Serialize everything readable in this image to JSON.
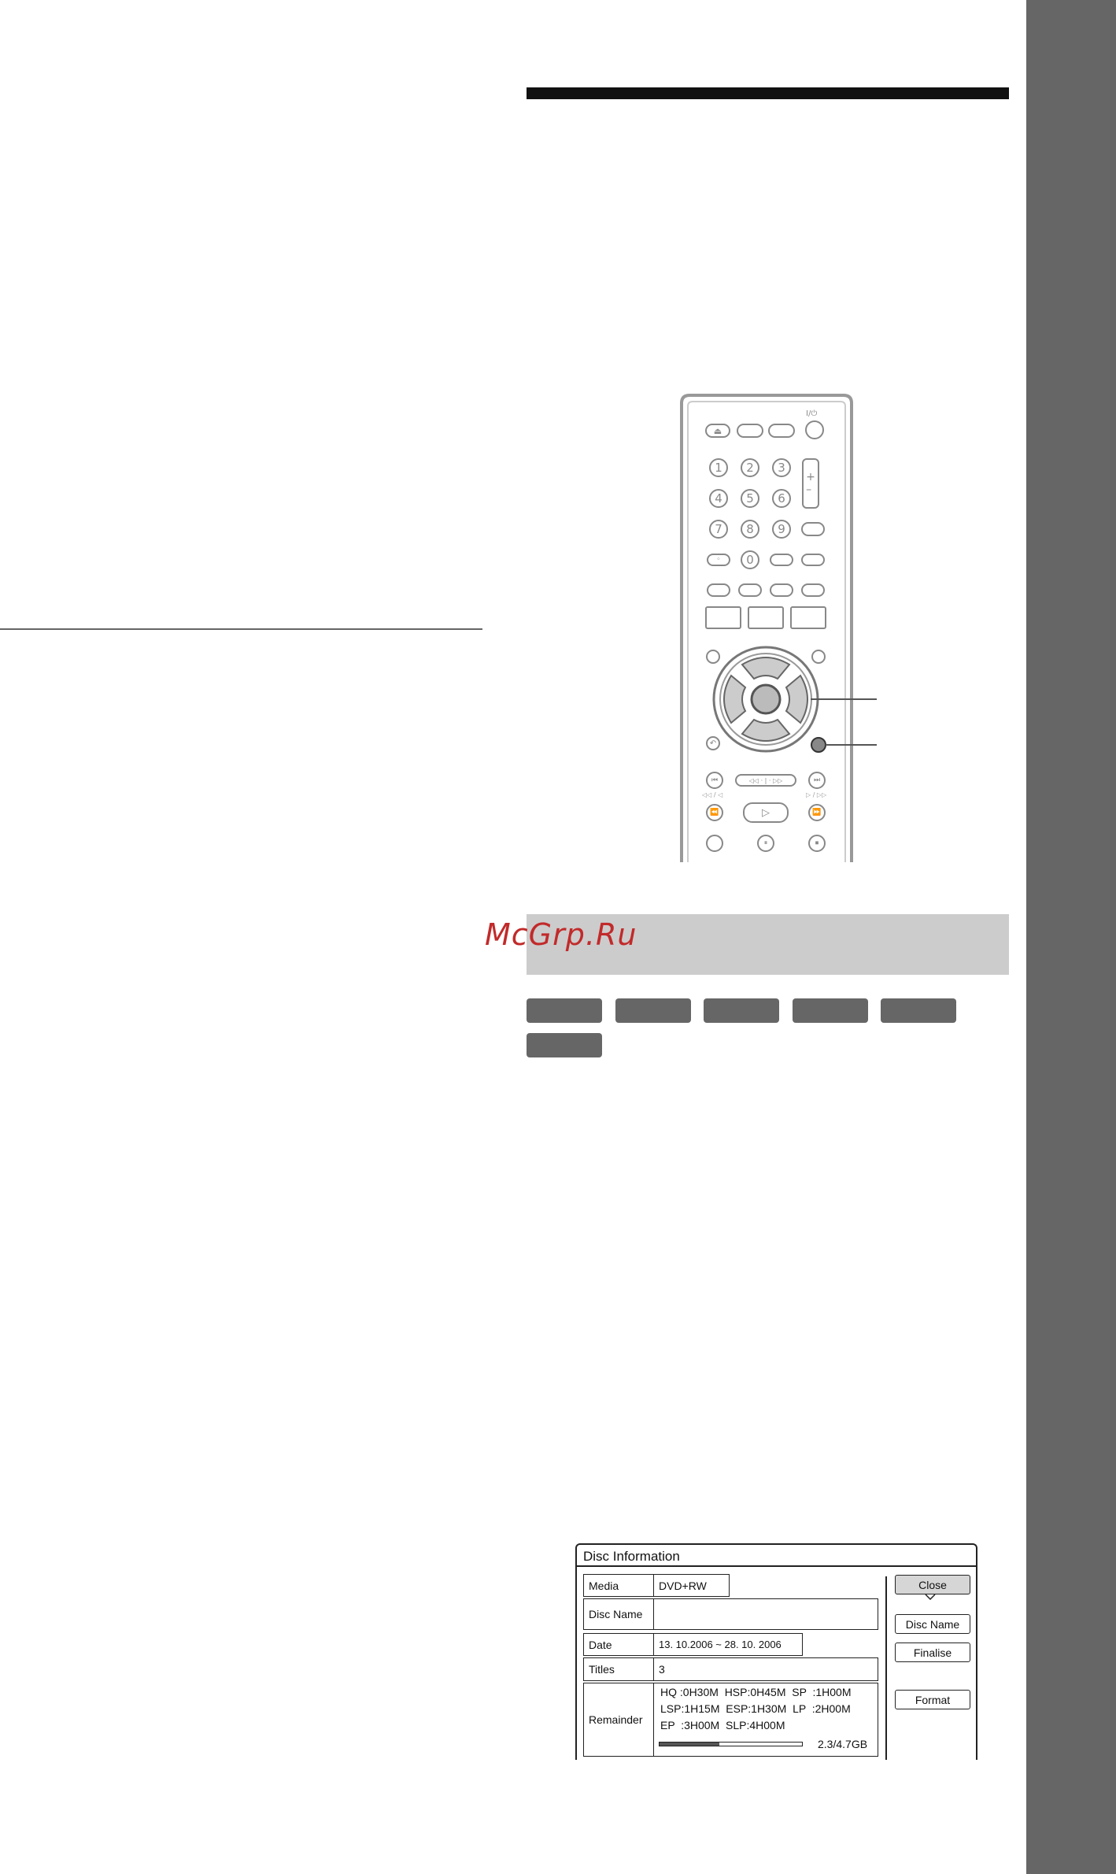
{
  "watermark": "McGrp.Ru",
  "remote": {
    "power_label": "I/⏻",
    "number_keys": [
      "1",
      "2",
      "3",
      "4",
      "5",
      "6",
      "7",
      "8",
      "9",
      "0"
    ],
    "enter_glyph": "⊚",
    "dpad_glyphs": [
      "▲",
      "◀",
      "▶",
      "▼"
    ],
    "transport_glyphs": [
      "⏮",
      "⏭",
      "⏪",
      "⏩",
      "▷",
      "⏸",
      "⏹"
    ],
    "skip_label_left": "◁◁ / ◁",
    "skip_label_right": "▷ / ▷▷"
  },
  "disc_info": {
    "title": "Disc Information",
    "labels": {
      "media": "Media",
      "disc_name": "Disc Name",
      "date": "Date",
      "titles": "Titles",
      "remainder": "Remainder"
    },
    "values": {
      "media": "DVD+RW",
      "disc_name": "",
      "date": "13. 10.2006 ~ 28. 10. 2006",
      "titles": "3"
    },
    "remainder_lines": [
      "HQ :0H30M  HSP:0H45M  SP  :1H00M",
      "LSP:1H15M  ESP:1H30M  LP  :2H00M",
      "EP  :3H00M  SLP:4H00M"
    ],
    "usage_text": "2.3/4.7GB",
    "usage_fraction": 0.42,
    "buttons": {
      "close": "Close",
      "disc_name": "Disc Name",
      "finalise": "Finalise",
      "format": "Format"
    }
  }
}
